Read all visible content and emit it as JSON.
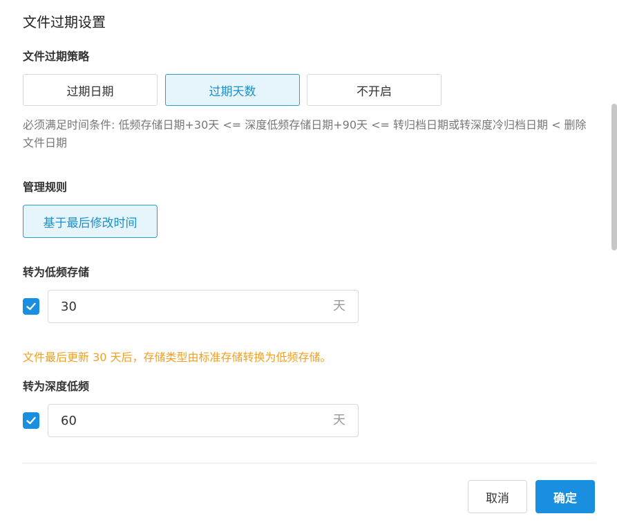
{
  "dialog": {
    "title": "文件过期设置"
  },
  "policy": {
    "label": "文件过期策略",
    "options": [
      {
        "label": "过期日期",
        "selected": false
      },
      {
        "label": "过期天数",
        "selected": true
      },
      {
        "label": "不开启",
        "selected": false
      }
    ],
    "hint": "必须满足时间条件: 低频存储日期+30天 <= 深度低频存储日期+90天 <= 转归档日期或转深度冷归档日期 < 删除文件日期"
  },
  "rule": {
    "label": "管理规则",
    "button_label": "基于最后修改时间"
  },
  "low_freq": {
    "label": "转为低频存储",
    "checked": true,
    "value": "30",
    "unit": "天",
    "notice": "文件最后更新 30 天后，存储类型由标准存储转换为低频存储。"
  },
  "deep_low_freq": {
    "label": "转为深度低频",
    "checked": true,
    "value": "60",
    "unit": "天"
  },
  "footer": {
    "cancel_label": "取消",
    "ok_label": "确定"
  },
  "colors": {
    "accent": "#1a8fdf",
    "active_bg": "#e6f5fc",
    "warning": "#f0a020"
  },
  "icons": {
    "checkbox": "check-icon"
  }
}
